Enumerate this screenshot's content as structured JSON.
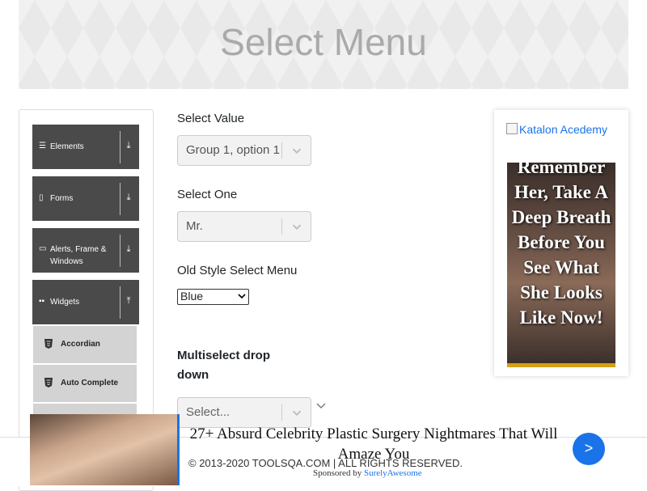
{
  "banner": {
    "title": "Select Menu"
  },
  "sidebar": {
    "groups": [
      {
        "icon": "hamburger-icon",
        "label": "Elements"
      },
      {
        "icon": "form-icon",
        "label": "Forms"
      },
      {
        "icon": "window-icon",
        "label": "Alerts, Frame & Windows"
      },
      {
        "icon": "widgets-icon",
        "label": "Widgets"
      }
    ],
    "items": [
      {
        "label": "Accordian"
      },
      {
        "label": "Auto Complete"
      }
    ]
  },
  "form": {
    "select_value": {
      "label": "Select Value",
      "value": "Group 1, option 1"
    },
    "select_one": {
      "label": "Select One",
      "value": "Mr."
    },
    "old_style": {
      "label": "Old Style Select Menu",
      "value": "Blue"
    },
    "multiselect": {
      "label": "Multiselect drop down",
      "placeholder": "Select..."
    }
  },
  "right_ad": {
    "link_text": "Katalon Acedemy",
    "headline": "Remember Her, Take A Deep Breath Before You See What She Looks Like Now!"
  },
  "bottom_ad": {
    "headline": "27+ Absurd Celebrity Plastic Surgery Nightmares That Will Amaze You",
    "sponsored_prefix": "Sponsored by",
    "sponsor": "SurelyAwesome",
    "next_label": ">"
  },
  "footer": {
    "copyright": "© 2013-2020 TOOLSQA.COM | ALL RIGHTS RESERVED."
  },
  "colors": {
    "sidebar_group": "#4a4a4a",
    "sidebar_item": "#d3d3d3",
    "link": "#1a73e8",
    "banner_text": "#aaaaaa"
  }
}
